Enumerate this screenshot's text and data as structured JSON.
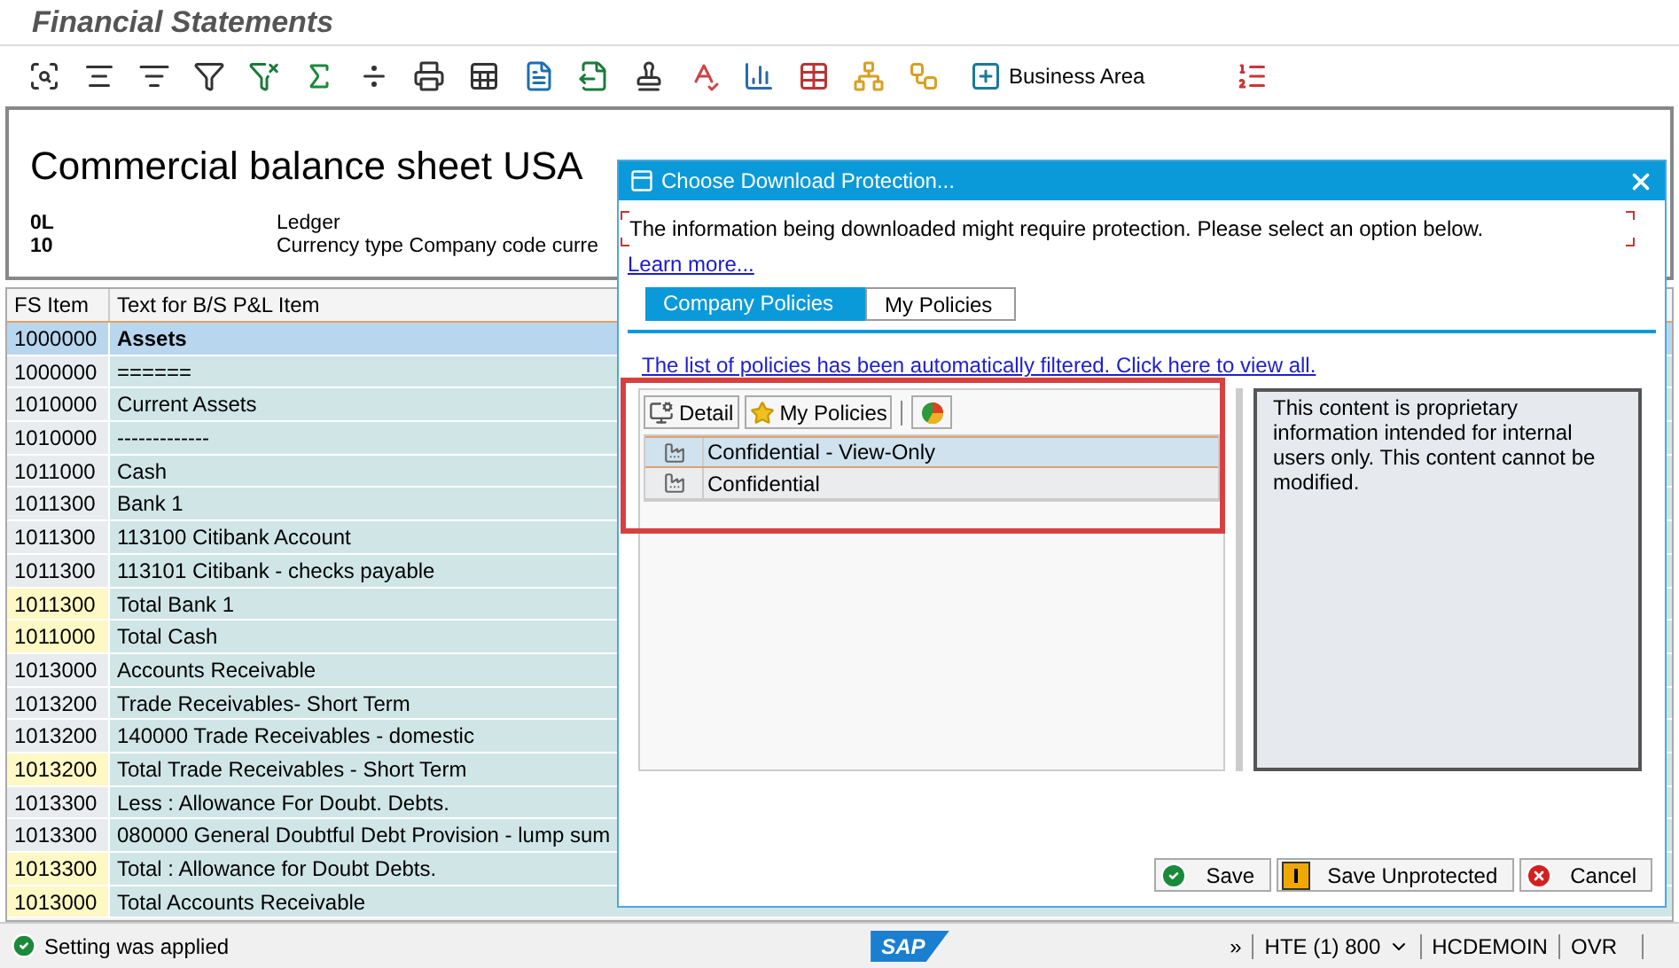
{
  "window": {
    "title": "Financial Statements"
  },
  "toolbar": {
    "business_area_button": "Business Area"
  },
  "report": {
    "title": "Commercial balance sheet USA",
    "fields": [
      {
        "code": "0L",
        "label": "Ledger"
      },
      {
        "code": "10",
        "label": "Currency type Company code curre"
      }
    ]
  },
  "table": {
    "columns": [
      "FS Item",
      "Text for B/S P&L Item"
    ],
    "rows": [
      {
        "item": "1000000",
        "text": "Assets",
        "selected": true,
        "highlighted": false
      },
      {
        "item": "1000000",
        "text": "======",
        "selected": false,
        "highlighted": false
      },
      {
        "item": "1010000",
        "text": "Current Assets",
        "selected": false,
        "highlighted": false
      },
      {
        "item": "1010000",
        "text": "-------------",
        "selected": false,
        "highlighted": false
      },
      {
        "item": "1011000",
        "text": "Cash",
        "selected": false,
        "highlighted": false
      },
      {
        "item": "1011300",
        "text": "Bank 1",
        "selected": false,
        "highlighted": false
      },
      {
        "item": "1011300",
        "text": "113100 Citibank Account",
        "selected": false,
        "highlighted": false
      },
      {
        "item": "1011300",
        "text": "113101 Citibank - checks payable",
        "selected": false,
        "highlighted": false
      },
      {
        "item": "1011300",
        "text": "Total Bank 1",
        "selected": false,
        "highlighted": true
      },
      {
        "item": "1011000",
        "text": "Total Cash",
        "selected": false,
        "highlighted": true
      },
      {
        "item": "1013000",
        "text": "Accounts Receivable",
        "selected": false,
        "highlighted": false
      },
      {
        "item": "1013200",
        "text": "Trade Receivables- Short Term",
        "selected": false,
        "highlighted": false
      },
      {
        "item": "1013200",
        "text": "140000 Trade Receivables - domestic",
        "selected": false,
        "highlighted": false
      },
      {
        "item": "1013200",
        "text": "Total Trade Receivables - Short Term",
        "selected": false,
        "highlighted": true
      },
      {
        "item": "1013300",
        "text": "Less : Allowance For Doubt. Debts.",
        "selected": false,
        "highlighted": false
      },
      {
        "item": "1013300",
        "text": "080000 General Doubtful Debt Provision - lump sum",
        "selected": false,
        "highlighted": false
      },
      {
        "item": "1013300",
        "text": "Total : Allowance for Doubt Debts.",
        "selected": false,
        "highlighted": true
      },
      {
        "item": "1013000",
        "text": "Total Accounts Receivable",
        "selected": false,
        "highlighted": true
      }
    ]
  },
  "dialog": {
    "title": "Choose Download Protection...",
    "message": "The information being downloaded might require protection. Please select an option below.",
    "learn_more": "Learn more...",
    "tabs": [
      {
        "label": "Company Policies",
        "selected": true
      },
      {
        "label": "My Policies",
        "selected": false
      }
    ],
    "filter_note": "The list of policies has been automatically filtered. Click here to view all.",
    "policy_toolbar": {
      "detail": "Detail",
      "my_policies": "My Policies"
    },
    "policies": [
      {
        "name": "Confidential - View-Only",
        "selected": true
      },
      {
        "name": "Confidential",
        "selected": false
      }
    ],
    "description": "This content is proprietary information intended for internal users only. This content cannot be modified.",
    "buttons": [
      {
        "label": "Save",
        "kind": "ok"
      },
      {
        "label": "Save Unprotected",
        "kind": "warning"
      },
      {
        "label": "Cancel",
        "kind": "cancel"
      }
    ]
  },
  "status_bar": {
    "message": "Setting was applied",
    "logo": "SAP",
    "more": "»",
    "system": "HTE (1) 800",
    "user": "HCDEMOIN",
    "mode": "OVR"
  }
}
